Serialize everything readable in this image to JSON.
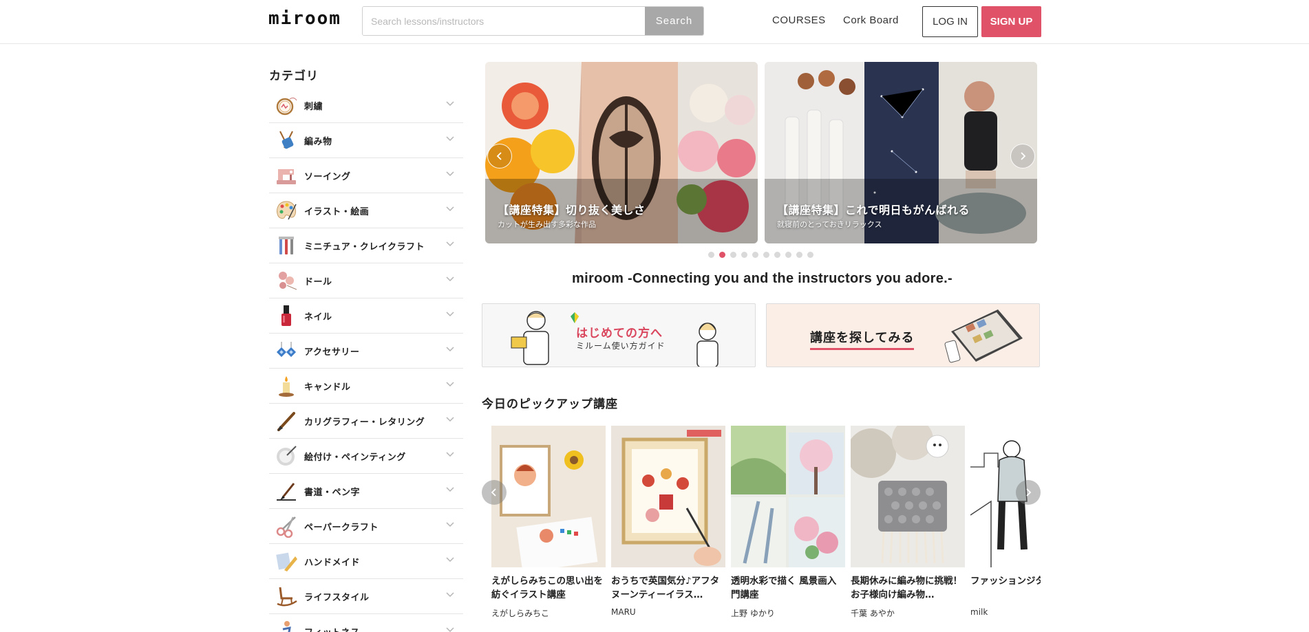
{
  "header": {
    "logo": "miroom",
    "search_placeholder": "Search lessons/instructors",
    "search_button": "Search",
    "nav": [
      "COURSES",
      "Cork Board"
    ],
    "login": "LOG IN",
    "signup": "SIGN UP"
  },
  "sidebar": {
    "title": "カテゴリ",
    "items": [
      {
        "label": "刺繍",
        "icon": "embroidery-hoop-icon"
      },
      {
        "label": "編み物",
        "icon": "yarn-needles-icon"
      },
      {
        "label": "ソーイング",
        "icon": "sewing-machine-icon"
      },
      {
        "label": "イラスト・絵画",
        "icon": "palette-icon"
      },
      {
        "label": "ミニチュア・クレイクラフト",
        "icon": "tools-icon"
      },
      {
        "label": "ドール",
        "icon": "doll-icon"
      },
      {
        "label": "ネイル",
        "icon": "nail-polish-icon"
      },
      {
        "label": "アクセサリー",
        "icon": "earrings-icon"
      },
      {
        "label": "キャンドル",
        "icon": "candle-icon"
      },
      {
        "label": "カリグラフィー・レタリング",
        "icon": "pen-nib-icon"
      },
      {
        "label": "絵付け・ペインティング",
        "icon": "painted-plate-icon"
      },
      {
        "label": "書道・ペン字",
        "icon": "calligraphy-brush-icon"
      },
      {
        "label": "ペーパークラフト",
        "icon": "scissors-icon"
      },
      {
        "label": "ハンドメイド",
        "icon": "handmade-icon"
      },
      {
        "label": "ライフスタイル",
        "icon": "rocking-chair-icon"
      },
      {
        "label": "フィットネス",
        "icon": "fitness-icon"
      }
    ]
  },
  "banners": [
    {
      "title": "【講座特集】切り抜く美しさ",
      "subtitle": "カットが生み出す多彩な作品"
    },
    {
      "title": "【講座特集】これで明日もがんばれる",
      "subtitle": "就寝前のとっておきリラックス"
    }
  ],
  "carousel": {
    "dot_count": 10,
    "active_index": 1
  },
  "tagline": "miroom -Connecting you and the instructors you adore.-",
  "guides": {
    "beginner_title": "はじめての方へ",
    "beginner_sub": "ミルーム使い方ガイド",
    "search_title": "講座を探してみる"
  },
  "pickup": {
    "title": "今日のピックアップ講座",
    "courses": [
      {
        "title": "えがしらみちこの思い出を紡ぐイラスト講座",
        "instructor": "えがしらみちこ"
      },
      {
        "title": "おうちで英国気分♪アフタヌーンティーイラス…",
        "instructor": "MARU"
      },
      {
        "title": "透明水彩で描く 風景画入門講座",
        "instructor": "上野 ゆかり"
      },
      {
        "title": "長期休みに編み物に挑戦！お子様向け編み物…",
        "instructor": "千葉 あやか"
      },
      {
        "title": "ファッションジタルイラス",
        "instructor": "milk"
      }
    ]
  },
  "colors": {
    "accent": "#e05268",
    "search_button": "#a8a8a8",
    "guide_warm": "#fbeee6"
  }
}
